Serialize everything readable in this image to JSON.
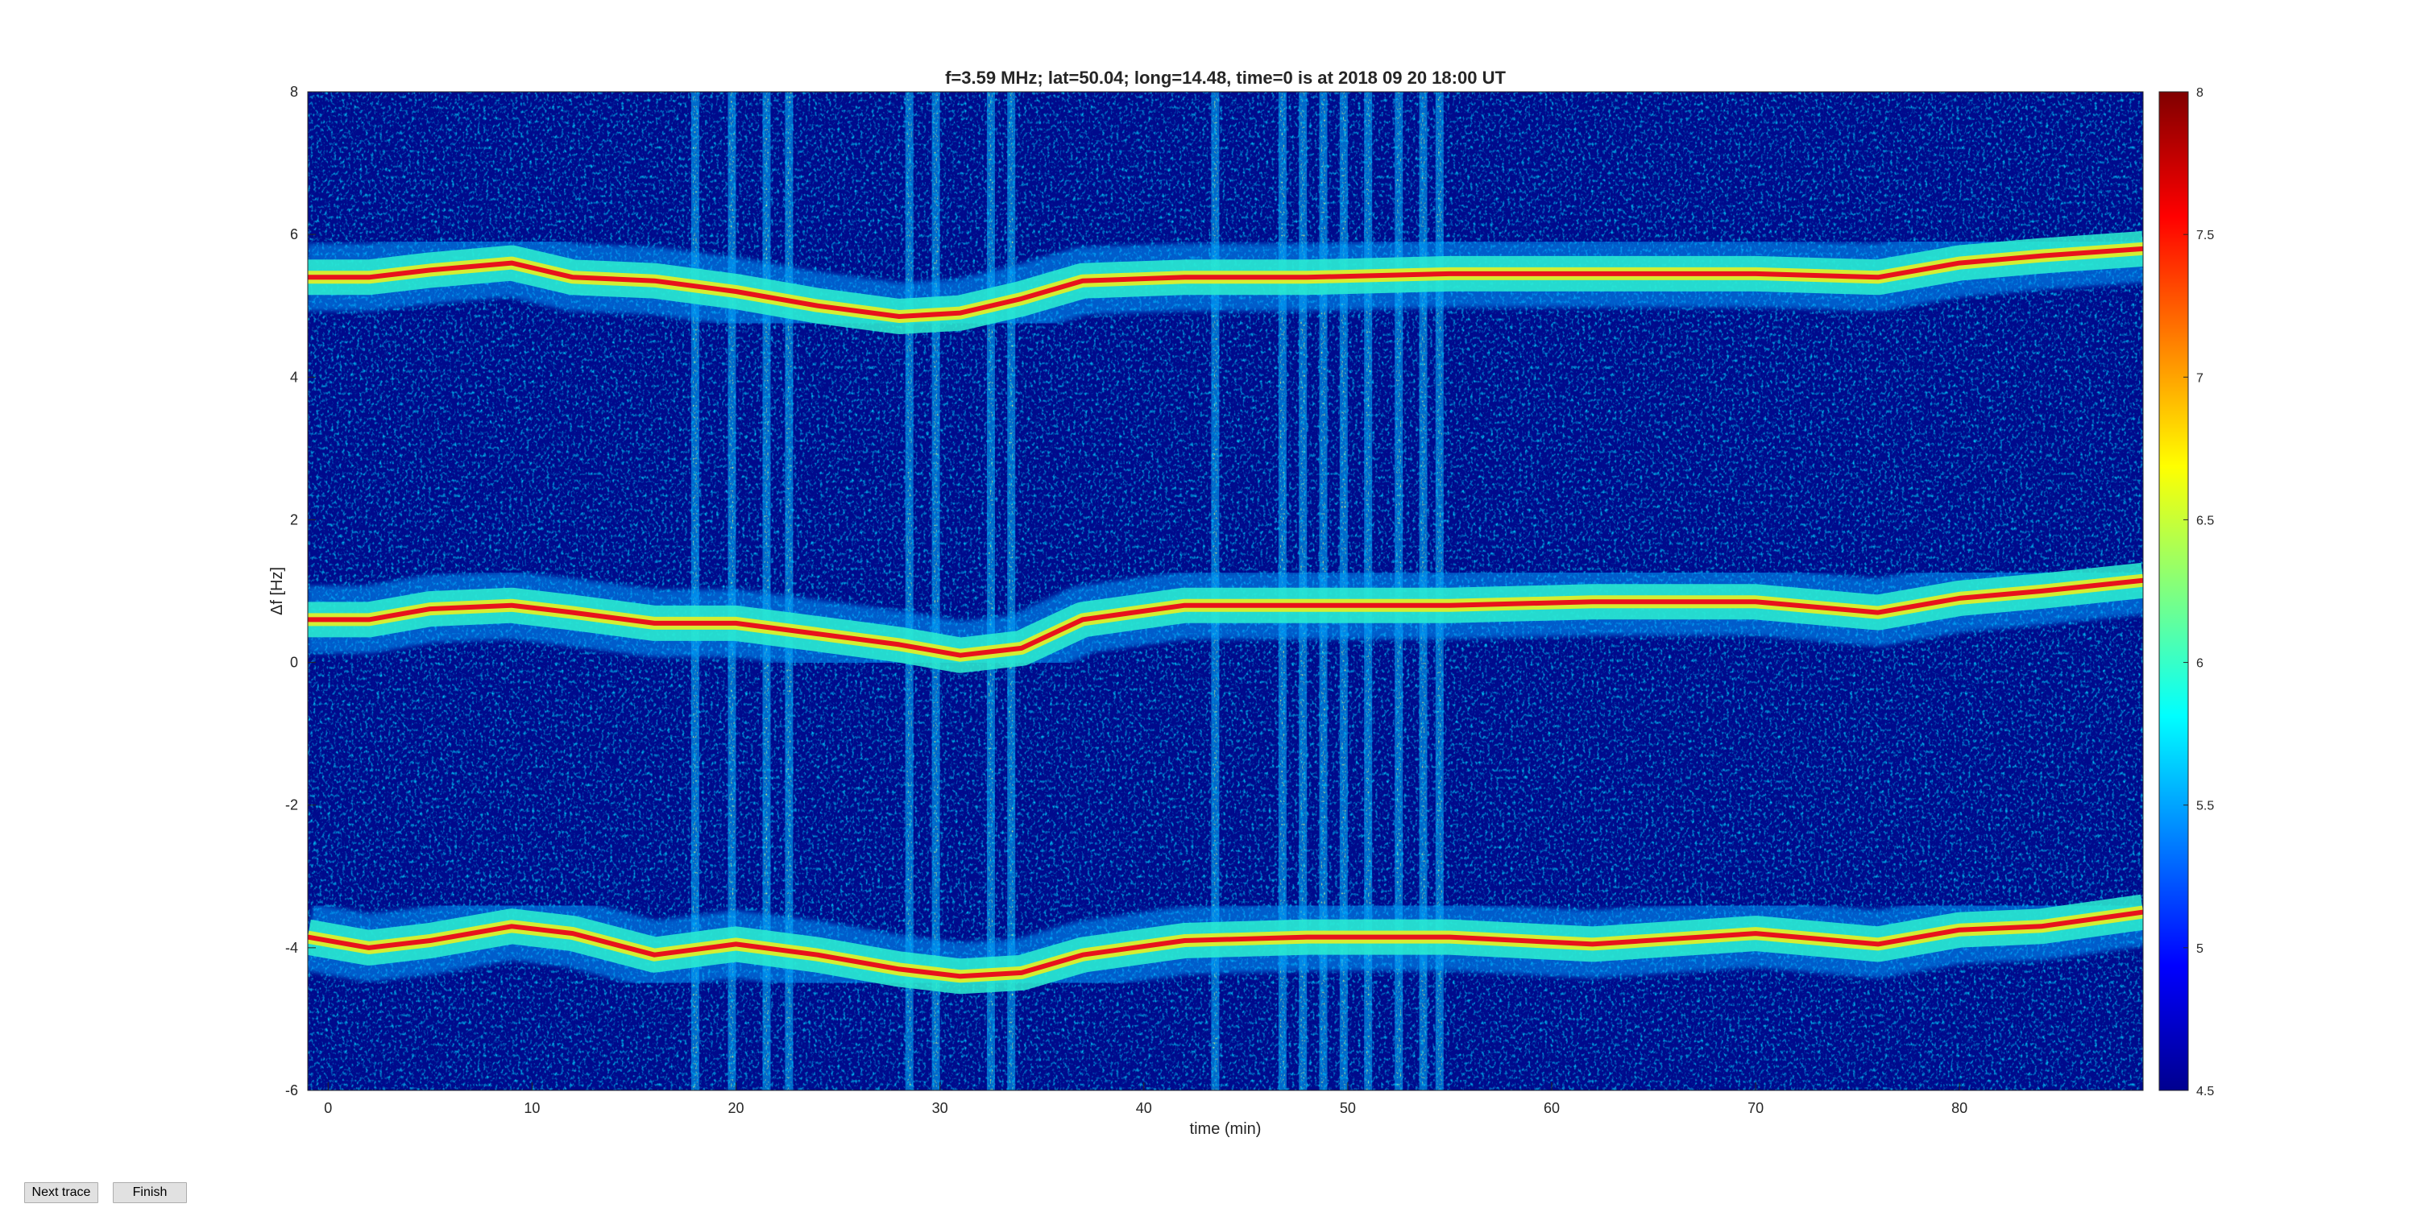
{
  "chart_data": {
    "type": "heatmap",
    "title": "f=3.59 MHz;  lat=50.04; long=14.48, time=0 is at 2018 09 20 18:00 UT",
    "xlabel": "time (min)",
    "ylabel": "Δf [Hz]",
    "xlim": [
      -1,
      89
    ],
    "ylim": [
      -6,
      8
    ],
    "x_ticks": [
      0,
      10,
      20,
      30,
      40,
      50,
      60,
      70,
      80
    ],
    "y_ticks": [
      -6,
      -4,
      -2,
      0,
      2,
      4,
      6,
      8
    ],
    "colorbar": {
      "colormap": "jet",
      "clim": [
        4.5,
        8
      ],
      "ticks": [
        4.5,
        5,
        5.5,
        6,
        6.5,
        7,
        7.5,
        8
      ]
    },
    "grid": false,
    "traces": [
      {
        "points": [
          [
            -1,
            5.4
          ],
          [
            2,
            5.4
          ],
          [
            5,
            5.5
          ],
          [
            9,
            5.6
          ],
          [
            12,
            5.4
          ],
          [
            16,
            5.35
          ],
          [
            20,
            5.2
          ],
          [
            24,
            5.0
          ],
          [
            28,
            4.85
          ],
          [
            31,
            4.9
          ],
          [
            34,
            5.1
          ],
          [
            37,
            5.35
          ],
          [
            42,
            5.4
          ],
          [
            48,
            5.4
          ],
          [
            55,
            5.45
          ],
          [
            62,
            5.45
          ],
          [
            70,
            5.45
          ],
          [
            76,
            5.4
          ],
          [
            80,
            5.6
          ],
          [
            84,
            5.7
          ],
          [
            89,
            5.8
          ]
        ]
      },
      {
        "points": [
          [
            -1,
            0.6
          ],
          [
            2,
            0.6
          ],
          [
            5,
            0.75
          ],
          [
            9,
            0.8
          ],
          [
            12,
            0.7
          ],
          [
            16,
            0.55
          ],
          [
            20,
            0.55
          ],
          [
            24,
            0.4
          ],
          [
            28,
            0.25
          ],
          [
            31,
            0.1
          ],
          [
            34,
            0.2
          ],
          [
            37,
            0.6
          ],
          [
            42,
            0.8
          ],
          [
            48,
            0.8
          ],
          [
            55,
            0.8
          ],
          [
            62,
            0.85
          ],
          [
            70,
            0.85
          ],
          [
            76,
            0.7
          ],
          [
            80,
            0.9
          ],
          [
            84,
            1.0
          ],
          [
            89,
            1.15
          ]
        ]
      },
      {
        "points": [
          [
            -1,
            -3.85
          ],
          [
            2,
            -4.0
          ],
          [
            5,
            -3.9
          ],
          [
            9,
            -3.7
          ],
          [
            12,
            -3.8
          ],
          [
            16,
            -4.1
          ],
          [
            20,
            -3.95
          ],
          [
            24,
            -4.1
          ],
          [
            28,
            -4.3
          ],
          [
            31,
            -4.4
          ],
          [
            34,
            -4.35
          ],
          [
            37,
            -4.1
          ],
          [
            42,
            -3.9
          ],
          [
            48,
            -3.85
          ],
          [
            55,
            -3.85
          ],
          [
            62,
            -3.95
          ],
          [
            70,
            -3.8
          ],
          [
            76,
            -3.95
          ],
          [
            80,
            -3.75
          ],
          [
            84,
            -3.7
          ],
          [
            89,
            -3.5
          ]
        ]
      }
    ],
    "interference_times": [
      18,
      19.8,
      21.5,
      22.6,
      28.5,
      29.8,
      32.5,
      33.5,
      43.5,
      46.8,
      47.8,
      48.8,
      49.8,
      51,
      52.5,
      53.7,
      54.5
    ]
  },
  "buttons": {
    "next_label": "Next trace",
    "finish_label": "Finish"
  }
}
